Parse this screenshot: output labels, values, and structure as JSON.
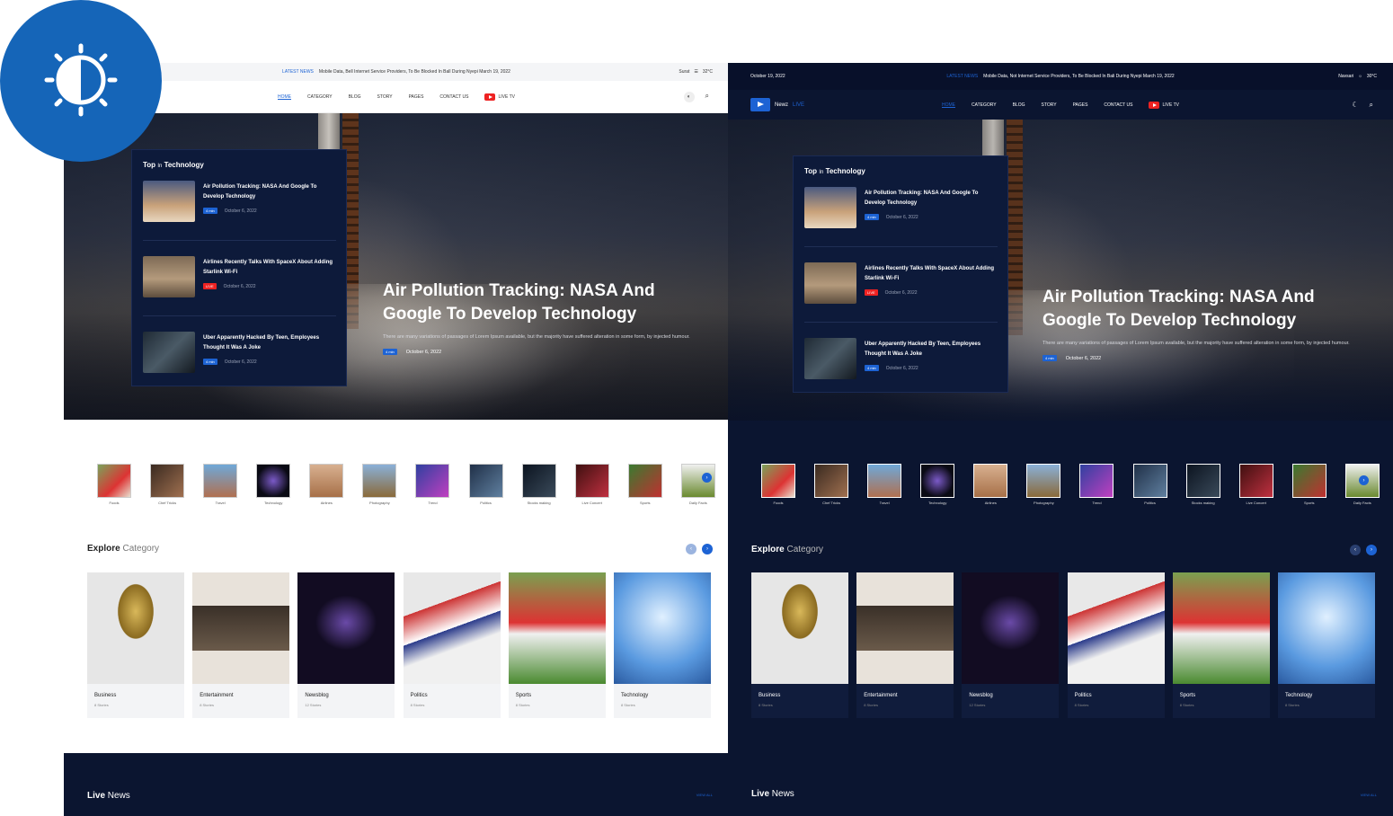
{
  "colors": {
    "accent": "#1d63d4",
    "dark_bg": "#0b1530",
    "live_red": "#e22"
  },
  "theme_toggle": {
    "icon": "brightness-icon"
  },
  "light": {
    "topbar": {
      "ticker_tag": "LATEST NEWS",
      "ticker_text": "Mobile Data, Bell Internet Service Providers, To Be Blocked In Ball During Nyepi March 19, 2022",
      "city": "Surat",
      "temp": "32°C"
    },
    "nav": [
      "HOME",
      "CATEGORY",
      "BLOG",
      "STORY",
      "PAGES",
      "CONTACT US",
      "LIVE TV"
    ]
  },
  "dark": {
    "topbar": {
      "date": "October 19, 2022",
      "ticker_tag": "LATEST NEWS",
      "ticker_text": "Mobile Data, Not Internet Service Providers, To Be Blocked In Bali During Nyepi March 19, 2022",
      "city": "Navsari",
      "temp": "30°C"
    },
    "brand": {
      "name": "Newz",
      "live": "LIVE"
    },
    "nav": [
      "HOME",
      "CATEGORY",
      "BLOG",
      "STORY",
      "PAGES",
      "CONTACT US",
      "LIVE TV"
    ]
  },
  "top_tech": {
    "title": "Top",
    "in": "In",
    "category": "Technology",
    "items": [
      {
        "title": "Air Pollution Tracking: NASA And Google To Develop Technology",
        "badge": "4 min",
        "date": "October 6, 2022"
      },
      {
        "title": "Airlines Recently Talks With SpaceX About Adding Starlink Wi-Fi",
        "badge": "LIVE",
        "date": "October 6, 2022"
      },
      {
        "title": "Uber Apparently Hacked By Teen, Employees Thought It Was A Joke",
        "badge": "4 min",
        "date": "October 6, 2022"
      }
    ]
  },
  "hero": {
    "title": "Air Pollution Tracking: NASA And Google To Develop Technology",
    "excerpt": "There are many variations of passages of Lorem Ipsum available, but the majority have suffered alteration in some form, by injected humour.",
    "badge": "4 min",
    "date": "October 6, 2022"
  },
  "categories_light": [
    "Foods",
    "Chef Tricks",
    "Travel",
    "Technology",
    "Airlines",
    "Photography",
    "Trend",
    "Politics",
    "Stocks making",
    "Live Concert",
    "Sports",
    "Daily Facts"
  ],
  "categories_dark": [
    "Foods",
    "Chef Tricks",
    "Travel",
    "Technology",
    "Airlines",
    "Photography",
    "Trend",
    "Politics",
    "Stocks making",
    "Live Concert",
    "Sports",
    "Daily Facts"
  ],
  "explore": {
    "title": "Explore",
    "sub": "Category"
  },
  "cards": [
    {
      "title": "Business",
      "stories": "8 Stories"
    },
    {
      "title": "Entertainment",
      "stories": "8 Stories"
    },
    {
      "title": "Newsblog",
      "stories": "12 Stories"
    },
    {
      "title": "Politics",
      "stories": "8 Stories"
    },
    {
      "title": "Sports",
      "stories": "8 Stories"
    },
    {
      "title": "Technology",
      "stories": "8 Stories"
    }
  ],
  "live": {
    "title": "Live",
    "sub": "News",
    "view_all": "VIEW ALL"
  }
}
